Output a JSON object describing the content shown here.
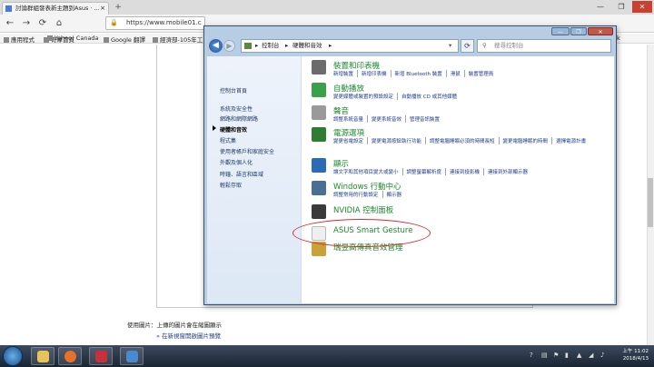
{
  "browser": {
    "tab_title": "討論群組發表新主題到Asus · ...",
    "tab_close": "×",
    "new_tab": "+",
    "window_buttons": [
      "—",
      "❐",
      "✕"
    ],
    "nav": {
      "back": "←",
      "forward": "→",
      "reload": "⟳",
      "home": "⌂"
    },
    "url": "https://www.mobile01.c",
    "bookmarks": [
      "應用程式",
      "奇摩首頁",
      "Yahoo! Canada",
      "Google 翻譯",
      "經濟部-105年工",
      "ook"
    ]
  },
  "page": {
    "photo_label": "使用圖片：上傳的圖片會在縮圖顯示",
    "preview_link": "» 在新視窗開啟圖片預覽"
  },
  "control_panel": {
    "breadcrumb": [
      "控制台",
      "硬體和音效"
    ],
    "search_placeholder": "搜尋控制台",
    "sidebar": [
      {
        "label": "控制台首頁",
        "active": false,
        "bullet": false
      },
      {
        "label": "系統及安全性",
        "active": false,
        "bullet": false
      },
      {
        "label": "網路和網際網路",
        "active": false,
        "bullet": false
      },
      {
        "label": "硬體和音效",
        "active": true,
        "bullet": true
      },
      {
        "label": "程式集",
        "active": false,
        "bullet": false
      },
      {
        "label": "使用者帳戶和家庭安全",
        "active": false,
        "bullet": false
      },
      {
        "label": "外觀及個人化",
        "active": false,
        "bullet": false
      },
      {
        "label": "時鐘、語言和區域",
        "active": false,
        "bullet": false
      },
      {
        "label": "輕鬆存取",
        "active": false,
        "bullet": false
      }
    ],
    "categories": [
      {
        "title": "裝置和印表機",
        "icon": "printer-icon",
        "color": "#6b6b6b",
        "links": [
          "新增裝置",
          "新增印表機",
          "新增 Bluetooth 裝置",
          "滑鼠",
          "裝置管理員"
        ]
      },
      {
        "title": "自動播放",
        "icon": "autoplay-icon",
        "color": "#3aa04a",
        "links": [
          "變更媒體或裝置的預設設定",
          "自動播放 CD 或其他媒體"
        ]
      },
      {
        "title": "聲音",
        "icon": "speaker-icon",
        "color": "#9a9a9a",
        "links": [
          "調整系統音量",
          "變更系統音效",
          "管理音訊裝置"
        ]
      },
      {
        "title": "電源選項",
        "icon": "power-options-icon",
        "color": "#2e7d32",
        "links": [
          "變更省電設定",
          "變更電源按鈕執行功能",
          "調整電腦睡眠必須的時間長短",
          "變更電腦睡眠的時間",
          "選擇電源計畫"
        ]
      },
      {
        "title": "顯示",
        "icon": "display-icon",
        "color": "#2d6bb5",
        "links": [
          "讓文字和其他項目變大或變小",
          "調整螢幕解析度",
          "連接到投影機",
          "連接到外部顯示器"
        ]
      },
      {
        "title": "Windows 行動中心",
        "icon": "mobility-center-icon",
        "color": "#4a6f95",
        "links": [
          "調整常用的行動設定",
          "顯示器"
        ]
      },
      {
        "title": "NVIDIA 控制面板",
        "icon": "nvidia-icon",
        "color": "#3a3a3a",
        "links": []
      },
      {
        "title": "ASUS Smart Gesture",
        "icon": "document-icon",
        "color": "#efefef",
        "links": []
      },
      {
        "title": "瑞昱高傳真音效管理",
        "icon": "realtek-audio-icon",
        "color": "#c9a23a",
        "links": []
      }
    ]
  },
  "taskbar": {
    "icons": [
      "explorer-icon",
      "firefox-icon",
      "app-icon",
      "control-panel-icon"
    ],
    "time": "上午 11:02",
    "date": "2018/4/13"
  }
}
